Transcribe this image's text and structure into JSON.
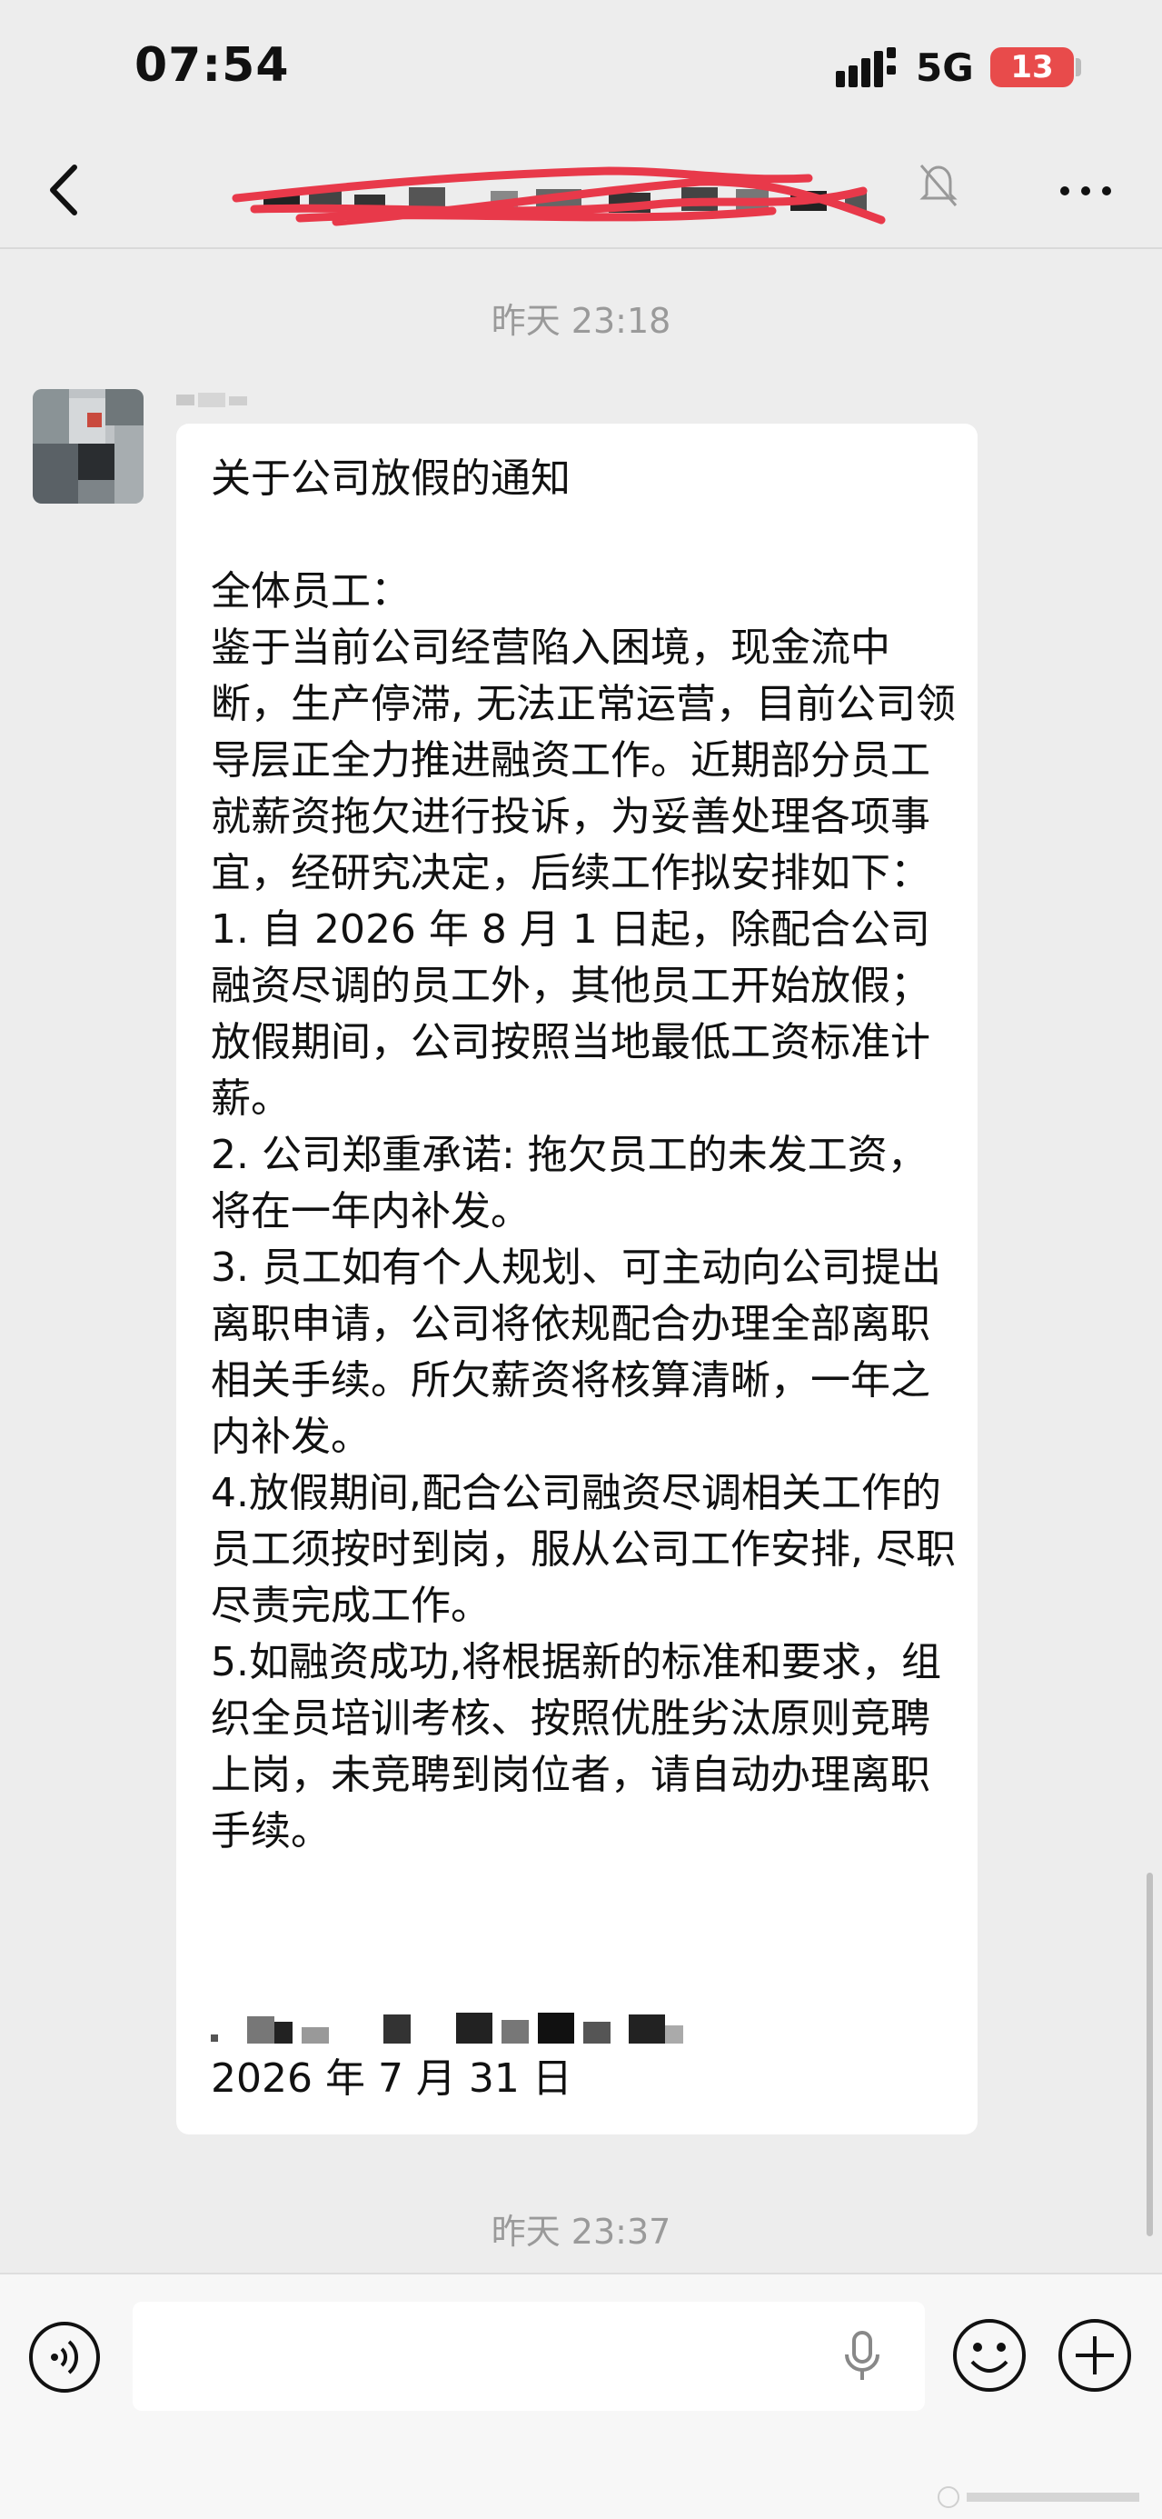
{
  "status_bar": {
    "time": "07:54",
    "network": "5G",
    "battery": "13"
  },
  "colors": {
    "background": "#ededed",
    "bubble": "#ffffff",
    "battery_low": "#e84b4b",
    "redaction_scribble": "#e8394a"
  },
  "nav": {
    "back_icon": "chevron-left-icon",
    "mute_icon": "bell-off-icon",
    "more_icon": "ellipsis-icon"
  },
  "messages": {
    "time_1": "昨天 23:18",
    "body": "关于公司放假的通知\n\n全体员工：\n鉴于当前公司经营陷入困境，现金流中断，生产停滞, 无法正常运营，目前公司领导层正全力推进融资工作。近期部分员工就薪资拖欠进行投诉，为妥善处理各项事宜，经研究决定，后续工作拟安排如下：\n1. 自 2026 年 8 月 1 日起，除配合公司融资尽调的员工外，其他员工开始放假；放假期间，公司按照当地最低工资标准计薪。\n2. 公司郑重承诺: 拖欠员工的未发工资，将在一年内补发。\n3. 员工如有个人规划、可主动向公司提出离职申请，公司将依规配合办理全部离职相关手续。所欠薪资将核算清晰，一年之内补发。\n4.放假期间,配合公司融资尽调相关工作的员工须按时到岗，服从公司工作安排, 尽职尽责完成工作。\n5.如融资成功,将根据新的标准和要求，组织全员培训考核、按照优胜劣汰原则竞聘上岗，未竞聘到岗位者，请自动办理离职手续。",
    "date": "2026 年 7 月 31 日",
    "time_2": "昨天 23:37"
  },
  "input_bar": {
    "voice_icon": "voice-icon",
    "mic_icon": "microphone-icon",
    "emoji_icon": "emoji-icon",
    "plus_icon": "plus-icon"
  }
}
